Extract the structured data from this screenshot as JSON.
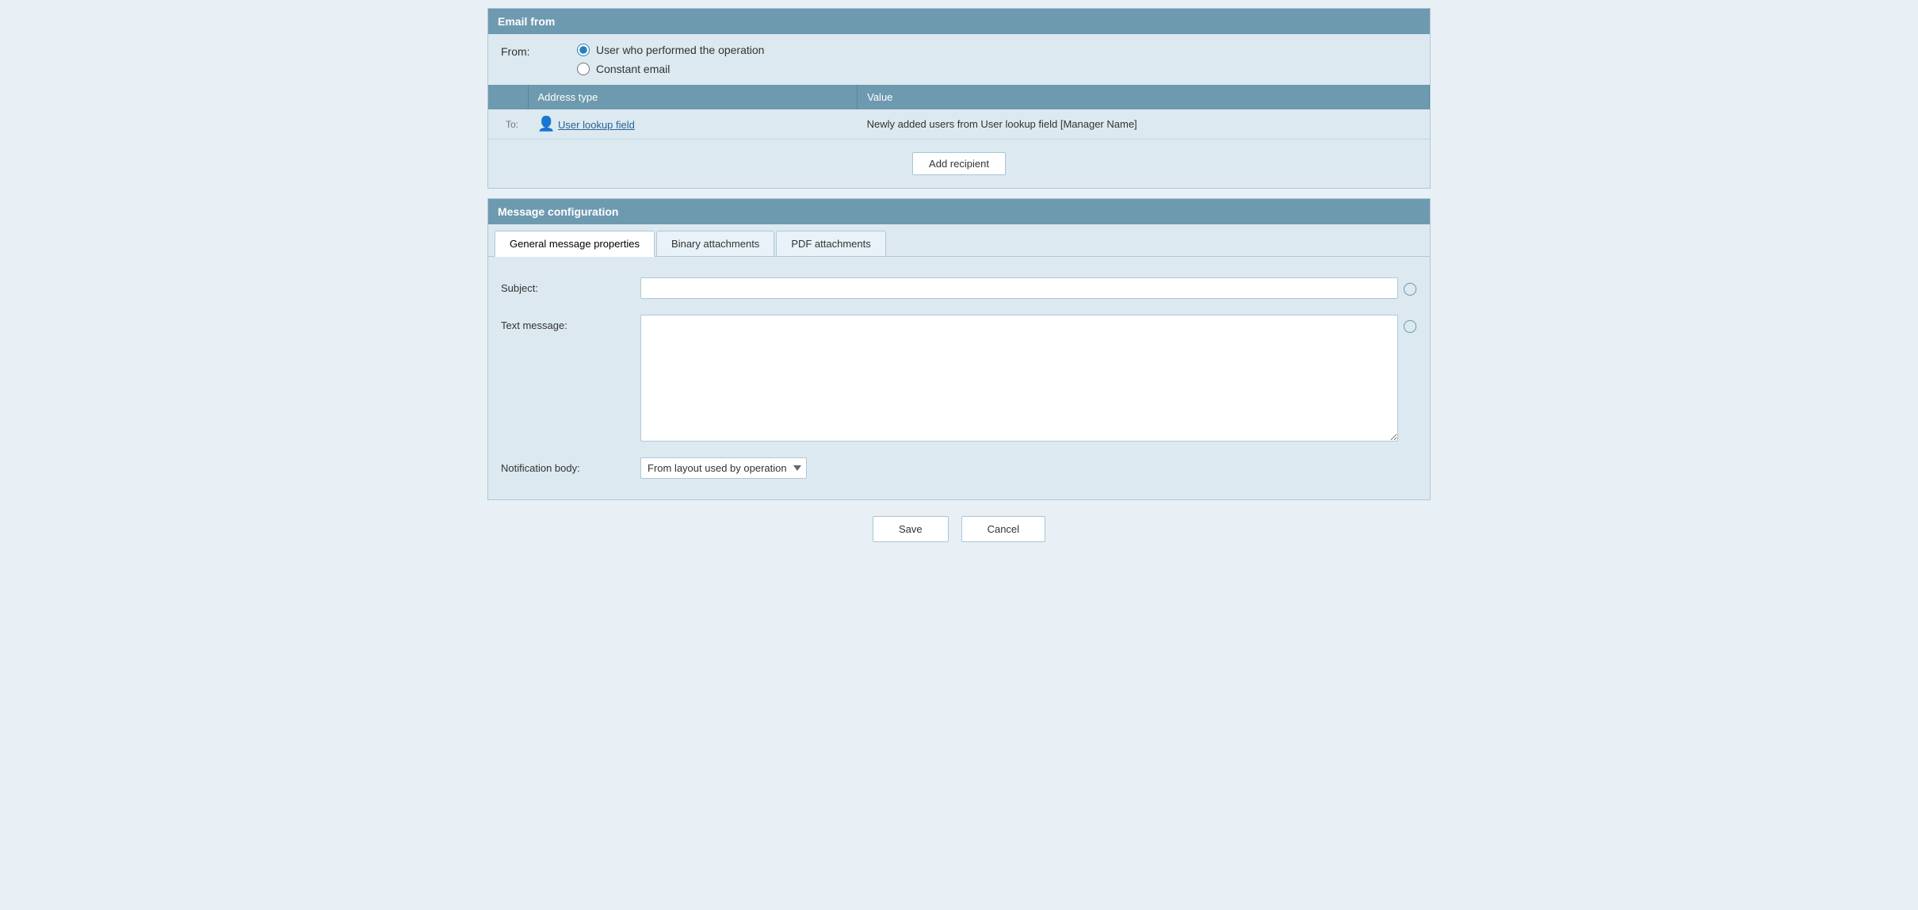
{
  "emailFrom": {
    "sectionTitle": "Email from",
    "fromLabel": "From:",
    "radioOptions": [
      {
        "id": "user-performed",
        "label": "User who performed the operation",
        "checked": true
      },
      {
        "id": "constant-email",
        "label": "Constant email",
        "checked": false
      }
    ]
  },
  "recipientsTable": {
    "columns": [
      {
        "id": "col-empty",
        "label": ""
      },
      {
        "id": "col-address-type",
        "label": "Address type"
      },
      {
        "id": "col-value",
        "label": "Value"
      }
    ],
    "rows": [
      {
        "toLabel": "To:",
        "icon": "👤",
        "addressType": "User lookup field",
        "value": "Newly added users from User lookup field [Manager Name]"
      }
    ],
    "addRecipientLabel": "Add recipient"
  },
  "messageConfig": {
    "sectionTitle": "Message configuration",
    "tabs": [
      {
        "id": "general",
        "label": "General message properties",
        "active": true
      },
      {
        "id": "binary",
        "label": "Binary attachments",
        "active": false
      },
      {
        "id": "pdf",
        "label": "PDF attachments",
        "active": false
      }
    ],
    "subjectLabel": "Subject:",
    "subjectPlaceholder": "",
    "textMessageLabel": "Text message:",
    "textMessagePlaceholder": "",
    "notificationBodyLabel": "Notification body:",
    "notificationBodyOptions": [
      {
        "value": "from-layout",
        "label": "From layout used by operation",
        "selected": true
      }
    ],
    "notificationBodySelected": "From layout used by operation"
  },
  "footer": {
    "saveLabel": "Save",
    "cancelLabel": "Cancel"
  }
}
